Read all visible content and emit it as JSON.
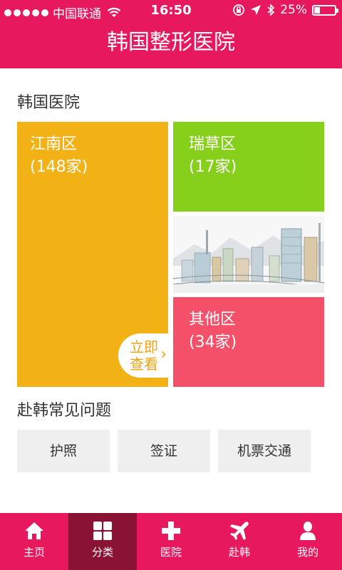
{
  "status_bar": {
    "carrier": "中国联通",
    "time": "16:50",
    "battery": "25%",
    "battery_level": 0.25
  },
  "header": {
    "title": "韩国整形医院"
  },
  "hospitals": {
    "section_title": "韩国医院",
    "tiles": [
      {
        "name": "江南区",
        "count": "(148家)",
        "color": "#f2b216"
      },
      {
        "name": "瑞草区",
        "count": "(17家)",
        "color": "#86cf1a"
      },
      {
        "name": "其他区",
        "count": "(34家)",
        "color": "#f4506a"
      }
    ],
    "view_now_line1": "立即",
    "view_now_line2": "查看"
  },
  "faq": {
    "section_title": "赴韩常见问题",
    "buttons": [
      "护照",
      "签证",
      "机票交通"
    ]
  },
  "tabbar": {
    "items": [
      {
        "label": "主页",
        "icon": "home-icon"
      },
      {
        "label": "分类",
        "icon": "grid-icon",
        "active": true
      },
      {
        "label": "医院",
        "icon": "plus-icon"
      },
      {
        "label": "赴韩",
        "icon": "airplane-icon"
      },
      {
        "label": "我的",
        "icon": "user-icon"
      }
    ]
  },
  "colors": {
    "brand": "#e8185e",
    "active_tab": "#8a1335"
  }
}
